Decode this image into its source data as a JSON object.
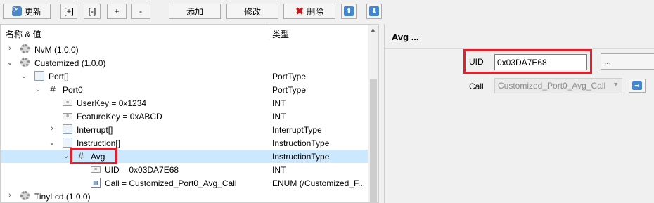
{
  "toolbar": {
    "refresh_label": "更新",
    "expand_label": "[+]",
    "collapse_label": "[-]",
    "plus_label": "+",
    "minus_label": "-",
    "add_label": "添加",
    "edit_label": "修改",
    "delete_label": "删除",
    "up_icon": "up-arrow-icon",
    "down_icon": "down-arrow-icon"
  },
  "tree": {
    "header_name": "名称 & 值",
    "header_type": "类型",
    "rows": [
      {
        "name": "NvM (1.0.0)",
        "type": "",
        "icon": "gear-icon",
        "chevron": "›"
      },
      {
        "name": "Customized (1.0.0)",
        "type": "",
        "icon": "gear-icon",
        "chevron": "⌄"
      },
      {
        "name": "Port[]",
        "type": "PortType",
        "icon": "box-icon",
        "chevron": "⌄"
      },
      {
        "name": "Port0",
        "type": "PortType",
        "icon": "hash-icon",
        "chevron": "⌄"
      },
      {
        "name": "UserKey = 0x1234",
        "type": "INT",
        "icon": "key-icon",
        "chevron": ""
      },
      {
        "name": "FeatureKey = 0xABCD",
        "type": "INT",
        "icon": "key-icon",
        "chevron": ""
      },
      {
        "name": "Interrupt[]",
        "type": "InterruptType",
        "icon": "box-icon",
        "chevron": "›"
      },
      {
        "name": "Instruction[]",
        "type": "InstructionType",
        "icon": "box-icon",
        "chevron": "⌄"
      },
      {
        "name": "Avg",
        "type": "InstructionType",
        "icon": "hash-icon",
        "chevron": "⌄"
      },
      {
        "name": "UID = 0x03DA7E68",
        "type": "INT",
        "icon": "key-icon",
        "chevron": ""
      },
      {
        "name": "Call = Customized_Port0_Avg_Call",
        "type": "ENUM (/Customized_F...",
        "icon": "enum-icon",
        "chevron": ""
      },
      {
        "name": "TinyLcd (1.0.0)",
        "type": "",
        "icon": "gear-icon",
        "chevron": "›"
      }
    ]
  },
  "detail": {
    "title": "Avg ...",
    "uid_label": "UID",
    "uid_value": "0x03DA7E68",
    "browse_label": "...",
    "call_label": "Call",
    "call_value": "Customized_Port0_Avg_Call",
    "goto_icon": "right-arrow-icon"
  },
  "colors": {
    "highlight": "#e0202a",
    "selection": "#cce8ff",
    "accent": "#3f86d6"
  }
}
